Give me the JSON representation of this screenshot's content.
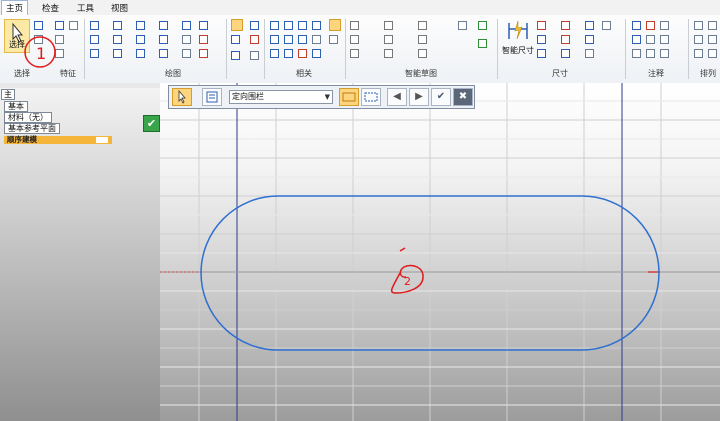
{
  "menu": {
    "tabs": [
      "主页",
      "检查",
      "工具",
      "视图"
    ]
  },
  "ribbon": {
    "select_label": "选择",
    "smart_dimension_label": "智能尺寸",
    "groups": [
      "选择",
      "特征",
      "绘图",
      "相关",
      "智能草图",
      "尺寸",
      "注释",
      "排列"
    ]
  },
  "tree": {
    "header": "主",
    "items": [
      "基本",
      "材料（无）",
      "基本参考平面"
    ],
    "active_item": "顺序建模"
  },
  "command_bar": {
    "dropdown_value": "定向围栏"
  },
  "annotations": {
    "mark_1": "1",
    "mark_2": "2"
  },
  "colors": {
    "sketch_outline": "#2f6fd0",
    "reference_red": "#d43a3a",
    "axis_blue": "#2b3a8f",
    "annotation_red": "#e01a1a"
  }
}
